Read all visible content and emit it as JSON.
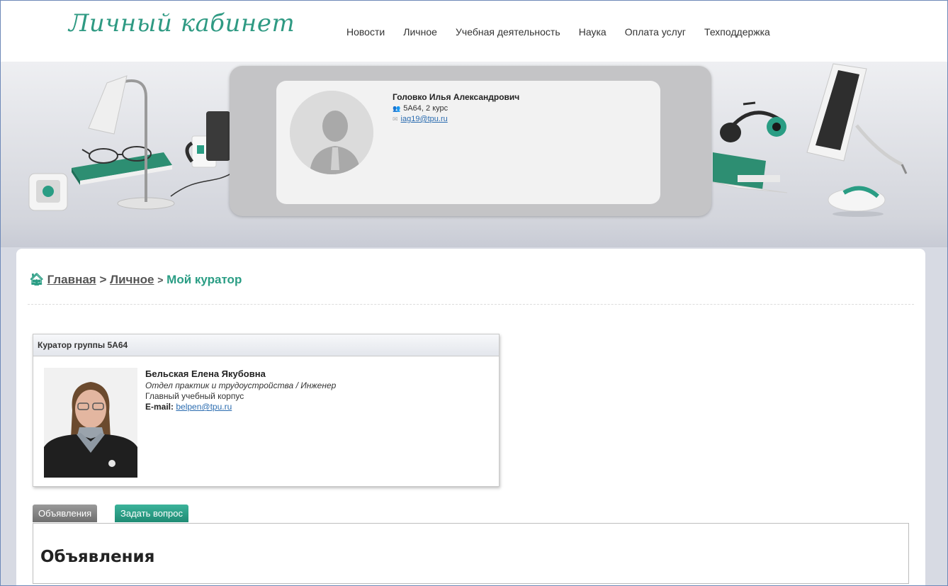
{
  "header": {
    "logo": "Личный кабинет",
    "nav": [
      "Новости",
      "Личное",
      "Учебная деятельность",
      "Наука",
      "Оплата услуг",
      "Техподдержка"
    ]
  },
  "profile": {
    "name": "Головко Илья Александрович",
    "group": "5А64, 2 курс",
    "email": "iag19@tpu.ru"
  },
  "breadcrumb": {
    "home": "Главная",
    "sep": ">",
    "personal": "Личное",
    "current": "Мой куратор"
  },
  "curator": {
    "title": "Куратор группы 5А64",
    "name": "Бельская Елена Якубовна",
    "department": "Отдел практик и трудоустройства / Инженер",
    "building": "Главный учебный корпус",
    "email_label": "E-mail:",
    "email": "belpen@tpu.ru"
  },
  "tabs": [
    {
      "label": "Объявления",
      "active": true
    },
    {
      "label": "Задать вопрос",
      "active": false
    }
  ],
  "panel": {
    "title": "Объявления"
  },
  "colors": {
    "accent": "#2a9d84",
    "link": "#2b6cb0"
  }
}
